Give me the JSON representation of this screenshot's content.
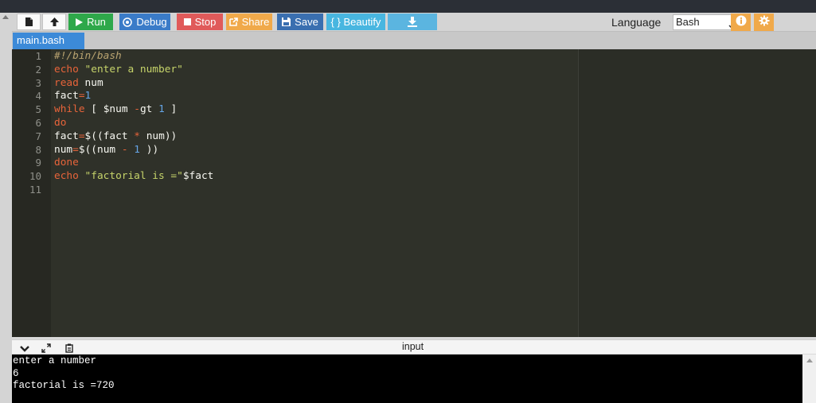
{
  "toolbar": {
    "run_label": "Run",
    "debug_label": "Debug",
    "stop_label": "Stop",
    "share_label": "Share",
    "save_label": "Save",
    "beautify_label": "{ } Beautify",
    "language_label": "Language",
    "language_value": "Bash",
    "colors": {
      "run": "#2ea84a",
      "debug": "#3a7bc8",
      "stop": "#e05a5a",
      "share": "#f0a94a",
      "save": "#3a6fb0",
      "beautify": "#48b6e0",
      "download": "#5bb5e0"
    },
    "icons": [
      "new-file-icon",
      "upload-icon",
      "play-icon",
      "debug-icon",
      "stop-icon",
      "share-icon",
      "save-icon",
      "download-icon",
      "info-icon",
      "settings-icon"
    ]
  },
  "tabs": [
    {
      "label": "main.bash",
      "active": true
    }
  ],
  "editor": {
    "line_numbers": [
      "1",
      "2",
      "3",
      "4",
      "5",
      "6",
      "7",
      "8",
      "9",
      "10",
      "11"
    ],
    "code": [
      "#!/bin/bash",
      "echo \"enter a number\"",
      "read num",
      "fact=1",
      "while [ $num -gt 1 ]",
      "do",
      "fact=$((fact * num))",
      "num=$((num - 1 ))",
      "done",
      "echo \"factorial is =\"$fact",
      ""
    ]
  },
  "io_panel": {
    "title": "input",
    "icons": [
      "collapse-icon",
      "expand-icon",
      "clipboard-icon"
    ]
  },
  "console": {
    "lines": [
      "enter a number",
      "6",
      "factorial is =720"
    ]
  }
}
